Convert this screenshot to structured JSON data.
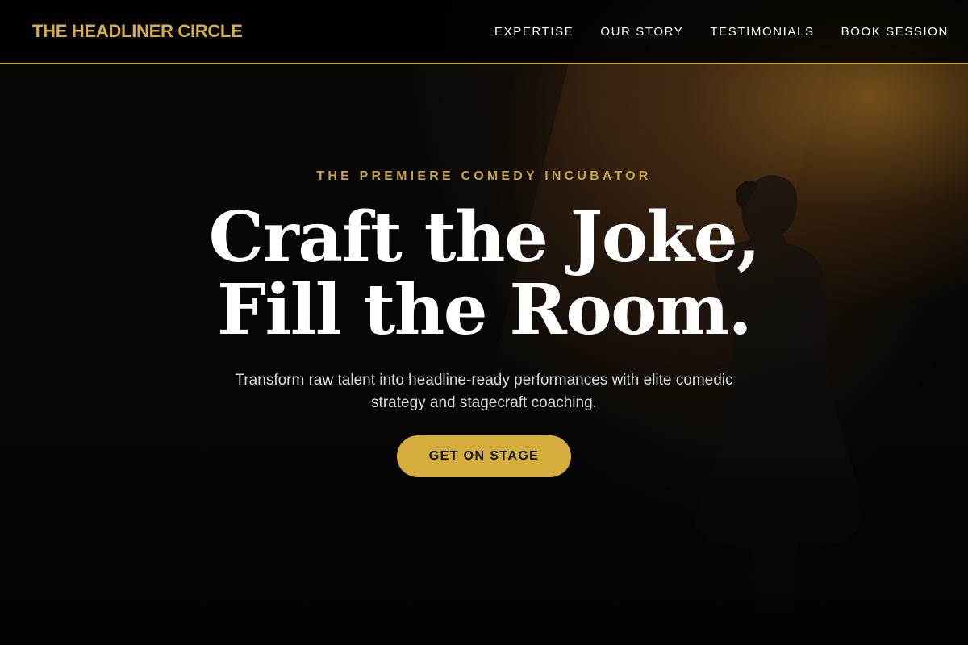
{
  "header": {
    "brand": "THE HEADLINER CIRCLE",
    "nav": [
      {
        "label": "EXPERTISE"
      },
      {
        "label": "OUR STORY"
      },
      {
        "label": "TESTIMONIALS"
      },
      {
        "label": "BOOK SESSION"
      }
    ]
  },
  "hero": {
    "eyebrow": "THE PREMIERE COMEDY INCUBATOR",
    "headline_line1": "Craft the Joke,",
    "headline_line2": "Fill the Room.",
    "subtext": "Transform raw talent into headline-ready performances with elite comedic strategy and stagecraft coaching.",
    "cta_label": "GET ON STAGE"
  },
  "colors": {
    "accent": "#d4ad3c",
    "background": "#050404",
    "text": "#ffffff"
  }
}
